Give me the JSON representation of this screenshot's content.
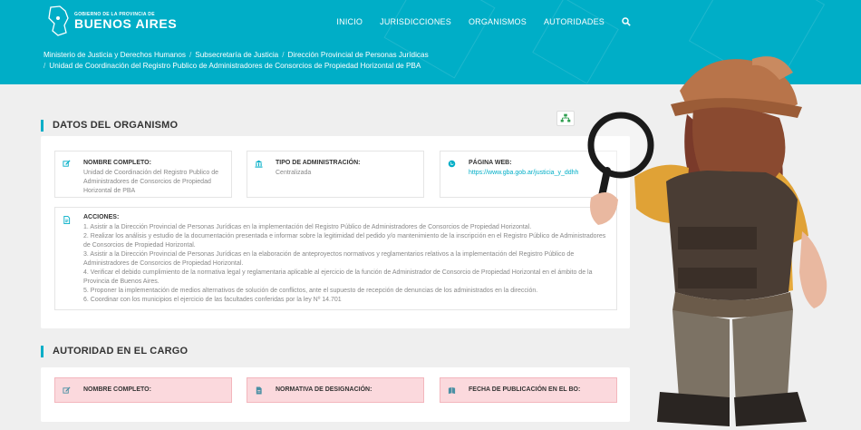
{
  "header": {
    "logo_small": "GOBIERNO DE LA PROVINCIA DE",
    "logo_big": "BUENOS AIRES",
    "nav": [
      "INICIO",
      "JURISDICCIONES",
      "ORGANISMOS",
      "AUTORIDADES"
    ],
    "search_icon": "search-icon"
  },
  "breadcrumb": [
    "Ministerio de Justicia y Derechos Humanos",
    "Subsecretaría de Justicia",
    "Dirección Provincial de Personas Jurídicas",
    "Unidad de Coordinación del Registro Publico de Administradores de Consorcios de Propiedad Horizontal de PBA"
  ],
  "datos": {
    "title": "DATOS DEL ORGANISMO",
    "nombre_label": "NOMBRE COMPLETO:",
    "nombre_value": "Unidad de Coordinación del Registro Publico de Administradores de Consorcios de Propiedad Horizontal de PBA",
    "tipo_label": "TIPO DE ADMINISTRACIÓN:",
    "tipo_value": "Centralizada",
    "web_label": "PÁGINA WEB:",
    "web_value": "https://www.gba.gob.ar/justicia_y_ddhh",
    "acciones_label": "ACCIONES:",
    "acciones": [
      "1. Asistir a la Dirección Provincial de Personas Jurídicas en la implementación del Registro Público de Administradores de Consorcios de Propiedad Horizontal.",
      "2. Realizar los análisis y estudio de la documentación presentada e informar sobre la legitimidad del pedido y/o mantenimiento de la inscripción en el Registro Público de Administradores de Consorcios de Propiedad Horizontal.",
      "3. Asistir a la Dirección Provincial de Personas Jurídicas en la elaboración de anteproyectos normativos y reglamentarios relativos a la implementación del Registro Público de Administradores de Consorcios de Propiedad Horizontal.",
      "4. Verificar el debido cumplimiento de la normativa legal y reglamentaria aplicable al ejercicio de la función de Administrador de Consorcio de Propiedad Horizontal en el ámbito de la Provincia de Buenos Aires.",
      "5. Proponer la implementación de medios alternativos de solución de conflictos, ante el supuesto de recepción de denuncias de los administrados en la dirección.",
      "6. Coordinar con los municipios el ejercicio de las facultades conferidas por la ley Nº 14.701"
    ]
  },
  "autoridad": {
    "title": "AUTORIDAD EN EL CARGO",
    "nombre_label": "NOMBRE COMPLETO:",
    "normativa_label": "NORMATIVA DE DESIGNACIÓN:",
    "fecha_label": "FECHA DE PUBLICACIÓN EN EL BO:"
  },
  "colors": {
    "accent": "#00aec7",
    "pink": "#fbd9dd"
  }
}
